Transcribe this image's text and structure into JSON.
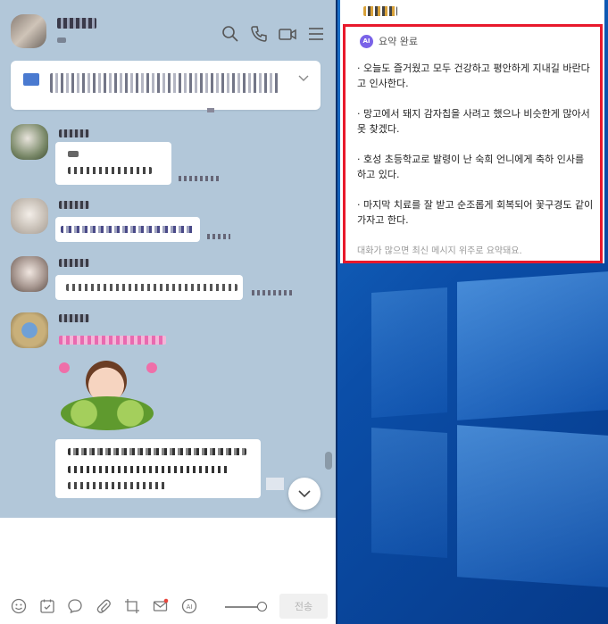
{
  "chat": {
    "toolbar": {
      "send_label": "전송"
    }
  },
  "summary": {
    "ai_badge": "AI",
    "title": "요약 완료",
    "items": [
      "· 오늘도 즐거웠고 모두 건강하고 평안하게 지내길 바란다고 인사한다.",
      "· 망고에서 돼지 감자칩을 사려고 했으나 비슷한게 많아서 못 찾겠다.",
      "· 호성 초등학교로 발령이 난 숙희 언니에게 축하 인사를 하고 있다.",
      "· 마지막 치료를 잘 받고 순조롭게 회복되어 꽃구경도 같이 가자고 한다."
    ],
    "footer": "대화가 많으면 최신 메시지 위주로 요약돼요."
  },
  "colors": {
    "chat_bg": "#b2c7d9",
    "highlight_border": "#e8192c",
    "ai_badge": "#7a63e8",
    "desktop_bg": "#0b4ea8"
  }
}
